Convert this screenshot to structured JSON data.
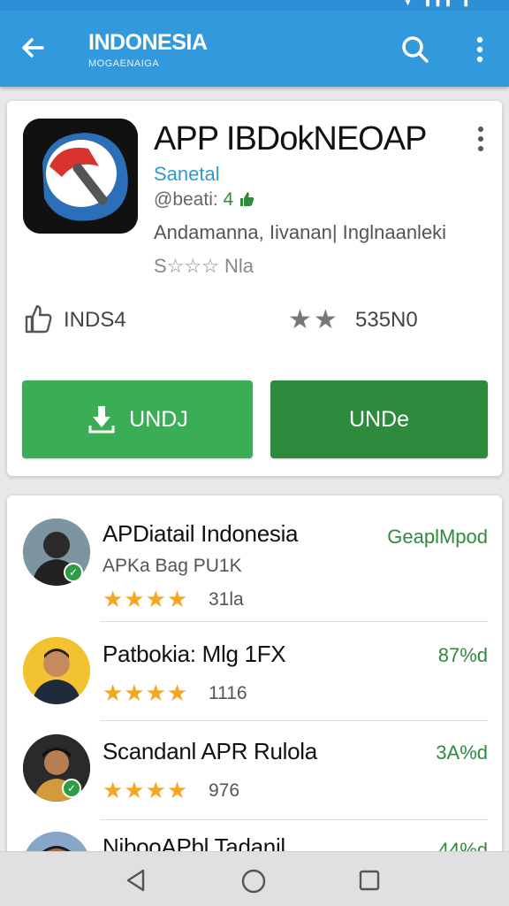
{
  "status_bar": {
    "icons": "▼ ▮▮▮ ▮"
  },
  "app_bar": {
    "title": "INDONESIA",
    "subtitle": "MOGAENAIGA",
    "back_icon": "arrow-left-icon",
    "search_icon": "search-icon",
    "more_icon": "more-vertical-icon"
  },
  "app": {
    "name": "APP IBDokNEOAP",
    "developer": "Sanetal",
    "rating_prefix": "@beati: ",
    "rating_value": "4",
    "category": "Andamanna, Iivanan| Inglnaanleki",
    "stars_text": "S☆☆☆ Nla",
    "downloads": "INDS4",
    "big_stars": "★★",
    "rating_count": "535N0",
    "install_label": "UNDJ",
    "open_label": "UNDe",
    "colors": {
      "install": "#3bad55",
      "open": "#2e8b3e",
      "developer": "#2f9bd0"
    }
  },
  "list": [
    {
      "title": "APDiatail Indonesia",
      "subtitle": "APKa Bag PU1K",
      "stars": "★★★★",
      "count": "31la",
      "action": "GeaplMpod",
      "badge": true
    },
    {
      "title": "Patbokia: Mlg 1FX",
      "subtitle": "",
      "stars": "★★★★",
      "count": "1116",
      "action": "87%d",
      "badge": false
    },
    {
      "title": "Scandanl APR Rulola",
      "subtitle": "",
      "stars": "★★★★",
      "count": "976",
      "action": "3A%d",
      "badge": true
    },
    {
      "title": "NibooAPbl Tadanil",
      "subtitle": "",
      "stars": "",
      "count": "",
      "action": "44%d",
      "badge": false
    }
  ],
  "nav_bar": {
    "back": "nav-back-icon",
    "home": "nav-home-icon",
    "recent": "nav-recent-icon"
  }
}
